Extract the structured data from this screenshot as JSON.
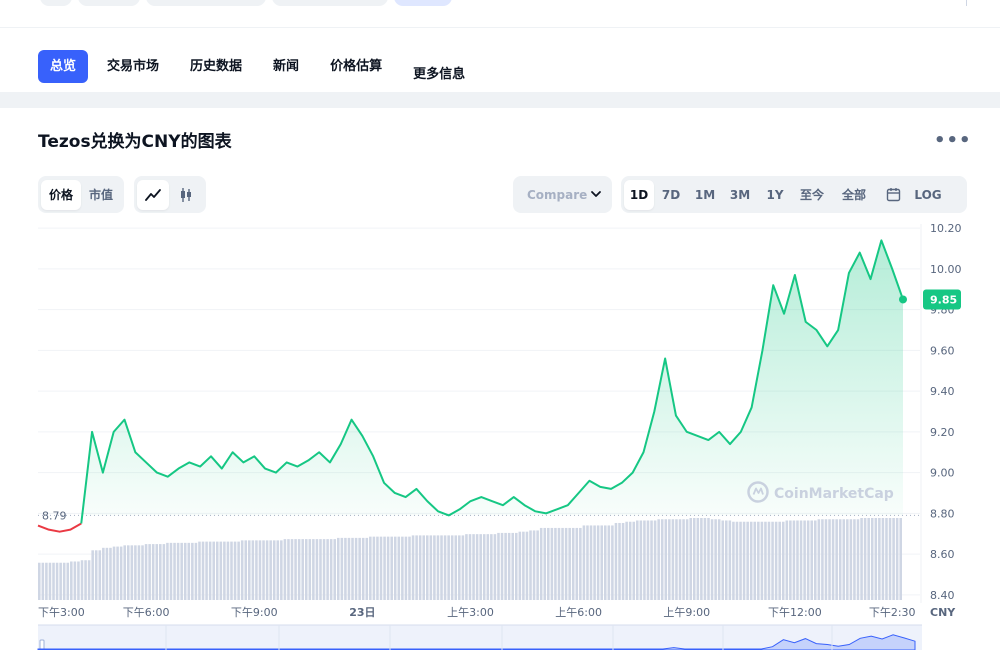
{
  "nav": {
    "tabs": [
      {
        "label": "总览",
        "active": true
      },
      {
        "label": "交易市场",
        "active": false
      },
      {
        "label": "历史数据",
        "active": false
      },
      {
        "label": "新闻",
        "active": false
      },
      {
        "label": "价格估算",
        "active": false
      },
      {
        "label": "更多信息",
        "active": false
      }
    ]
  },
  "chart_header": {
    "title": "Tezos兑换为CNY的图表",
    "menu_icon": "more-dots-icon"
  },
  "controls": {
    "metric_tabs": [
      "价格",
      "市值"
    ],
    "metric_active": "价格",
    "chart_style_icons": [
      "line-chart-icon",
      "candlestick-icon"
    ],
    "chart_style_active": "line-chart-icon",
    "compare_label": "Compare",
    "ranges": [
      "1D",
      "7D",
      "1M",
      "3M",
      "1Y",
      "至今",
      "全部"
    ],
    "range_active": "1D",
    "calendar_icon": "calendar-icon",
    "log_label": "LOG"
  },
  "colors": {
    "up": "#16c784",
    "down": "#ea3943",
    "accent": "#3861fb",
    "volume": "#cfd6e4"
  },
  "chart_data": {
    "type": "area",
    "currency": "CNY",
    "watermark": "CoinMarketCap",
    "open_price": 8.79,
    "open_label": "8.79",
    "current_price": 9.85,
    "current_label": "9.85",
    "yticks": [
      "10.20",
      "10.00",
      "9.80",
      "9.60",
      "9.40",
      "9.20",
      "9.00",
      "8.80",
      "8.60",
      "8.40"
    ],
    "ylim": [
      8.36,
      10.24
    ],
    "xticks": [
      "下午3:00",
      "下午6:00",
      "下午9:00",
      "23日",
      "上午3:00",
      "上午6:00",
      "上午9:00",
      "下午12:00",
      "下午2:30"
    ],
    "series": [
      {
        "x": [
          0,
          0.3,
          0.6,
          0.9,
          1.2,
          1.5,
          1.8,
          2.1,
          2.4,
          2.7,
          3.0,
          3.3,
          3.6,
          3.9,
          4.2,
          4.5,
          4.8,
          5.1,
          5.4,
          5.7,
          6.0,
          6.3,
          6.6,
          6.9,
          7.2,
          7.5,
          7.8,
          8.1,
          8.4,
          8.7,
          9.0,
          9.3,
          9.6,
          9.9,
          10.2,
          10.5,
          10.8,
          11.1,
          11.4,
          11.7,
          12.0,
          12.3,
          12.6,
          12.9,
          13.2,
          13.5,
          13.8,
          14.1,
          14.4,
          14.7,
          15.0,
          15.3,
          15.6,
          15.9,
          16.2,
          16.5,
          16.8,
          17.1,
          17.4,
          17.7,
          18.0,
          18.3,
          18.6,
          18.9,
          19.2,
          19.5,
          19.8,
          20.1,
          20.4,
          20.7,
          21.0,
          21.3,
          21.6,
          21.9,
          22.2,
          22.5,
          22.8,
          23.1,
          23.4,
          23.7,
          24.0
        ],
        "values": [
          8.74,
          8.72,
          8.71,
          8.72,
          8.75,
          9.2,
          9.0,
          9.2,
          9.26,
          9.1,
          9.05,
          9.0,
          8.98,
          9.02,
          9.05,
          9.03,
          9.08,
          9.02,
          9.1,
          9.05,
          9.08,
          9.02,
          9.0,
          9.05,
          9.03,
          9.06,
          9.1,
          9.05,
          9.14,
          9.26,
          9.18,
          9.08,
          8.95,
          8.9,
          8.88,
          8.92,
          8.86,
          8.81,
          8.79,
          8.82,
          8.86,
          8.88,
          8.86,
          8.84,
          8.88,
          8.84,
          8.81,
          8.8,
          8.82,
          8.84,
          8.9,
          8.96,
          8.93,
          8.92,
          8.95,
          9.0,
          9.1,
          9.3,
          9.56,
          9.28,
          9.2,
          9.18,
          9.16,
          9.2,
          9.14,
          9.2,
          9.32,
          9.6,
          9.92,
          9.78,
          9.97,
          9.74,
          9.7,
          9.62,
          9.7,
          9.98,
          10.08,
          9.95,
          10.14,
          10.0,
          9.85
        ],
        "marker_up": "#16c784",
        "marker_down": "#ea3943"
      }
    ],
    "volume": {
      "x_start": 0,
      "x_end": 24,
      "values": [
        0.3,
        0.3,
        0.3,
        0.31,
        0.32,
        0.4,
        0.42,
        0.43,
        0.44,
        0.44,
        0.45,
        0.45,
        0.46,
        0.46,
        0.46,
        0.47,
        0.47,
        0.47,
        0.47,
        0.48,
        0.48,
        0.48,
        0.48,
        0.49,
        0.49,
        0.49,
        0.49,
        0.49,
        0.5,
        0.5,
        0.5,
        0.51,
        0.51,
        0.51,
        0.51,
        0.52,
        0.52,
        0.52,
        0.52,
        0.52,
        0.53,
        0.53,
        0.53,
        0.54,
        0.54,
        0.55,
        0.56,
        0.58,
        0.58,
        0.58,
        0.58,
        0.6,
        0.6,
        0.6,
        0.62,
        0.63,
        0.64,
        0.64,
        0.65,
        0.65,
        0.65,
        0.66,
        0.66,
        0.65,
        0.64,
        0.63,
        0.63,
        0.63,
        0.63,
        0.63,
        0.64,
        0.64,
        0.64,
        0.65,
        0.65,
        0.65,
        0.65,
        0.66,
        0.66,
        0.66,
        0.66
      ]
    }
  }
}
